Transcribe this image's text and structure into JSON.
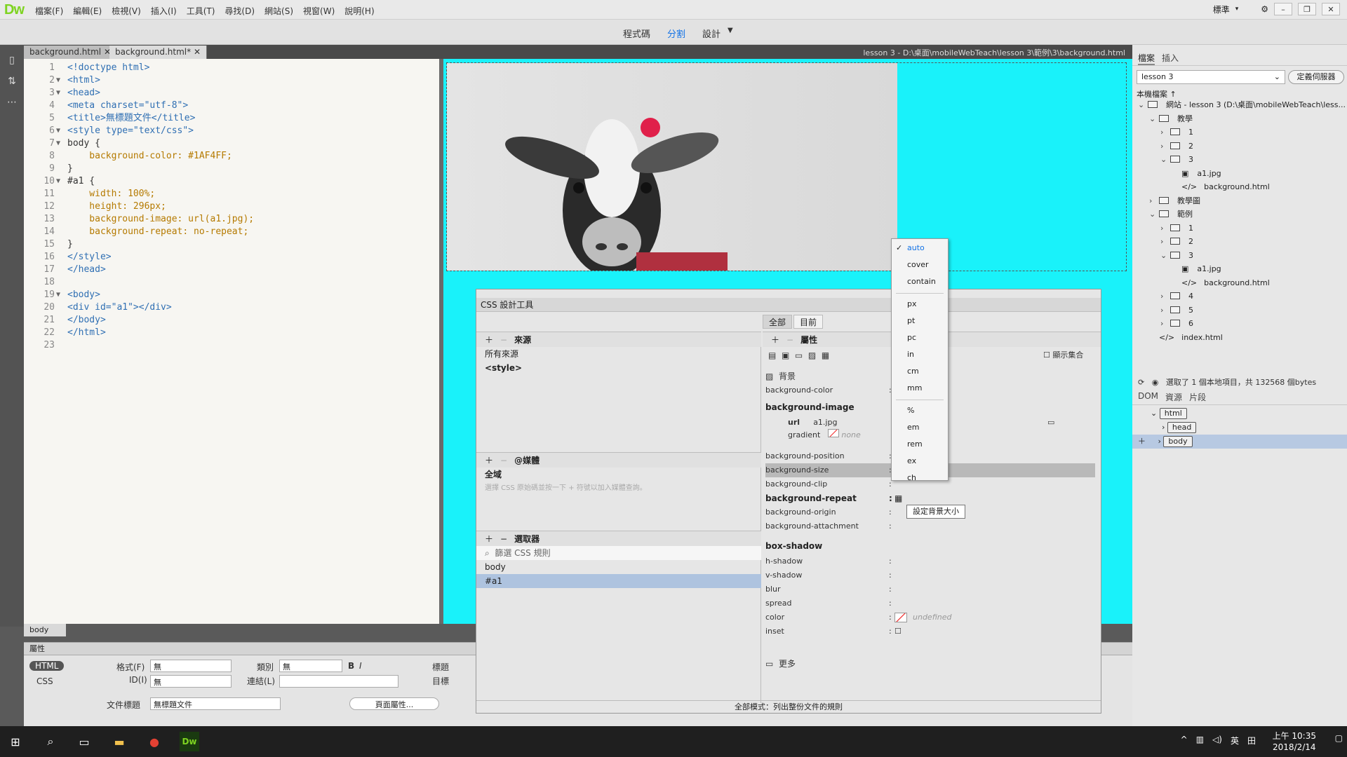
{
  "app": {
    "logo": "Dw",
    "menus": [
      "檔案(F)",
      "編輯(E)",
      "檢視(V)",
      "插入(I)",
      "工具(T)",
      "尋找(D)",
      "網站(S)",
      "視窗(W)",
      "說明(H)"
    ],
    "workspace": "標準"
  },
  "view_tabs": [
    "程式碼",
    "分割",
    "設計"
  ],
  "doc_tabs": [
    "background.html",
    "background.html*"
  ],
  "doc_path": "lesson 3 - D:\\桌面\\mobileWebTeach\\lesson 3\\範例\\3\\background.html",
  "code_lines": [
    {
      "n": "1",
      "t": "<!doctype html>"
    },
    {
      "n": "2",
      "t": "<html>"
    },
    {
      "n": "3",
      "t": "<head>"
    },
    {
      "n": "4",
      "t": "<meta charset=\"utf-8\">"
    },
    {
      "n": "5",
      "t": "<title>無標題文件</title>"
    },
    {
      "n": "6",
      "t": "<style type=\"text/css\">"
    },
    {
      "n": "7",
      "t": "body {"
    },
    {
      "n": "8",
      "t": "    background-color: #1AF4FF;"
    },
    {
      "n": "9",
      "t": "}"
    },
    {
      "n": "10",
      "t": "#a1 {"
    },
    {
      "n": "11",
      "t": "    width: 100%;"
    },
    {
      "n": "12",
      "t": "    height: 296px;"
    },
    {
      "n": "13",
      "t": "    background-image: url(a1.jpg);"
    },
    {
      "n": "14",
      "t": "    background-repeat: no-repeat;"
    },
    {
      "n": "15",
      "t": "}"
    },
    {
      "n": "16",
      "t": "</style>"
    },
    {
      "n": "17",
      "t": "</head>"
    },
    {
      "n": "18",
      "t": ""
    },
    {
      "n": "19",
      "t": "<body>"
    },
    {
      "n": "20",
      "t": "<div id=\"a1\"></div>"
    },
    {
      "n": "21",
      "t": "</body>"
    },
    {
      "n": "22",
      "t": "</html>"
    },
    {
      "n": "23",
      "t": ""
    }
  ],
  "files_panel": {
    "tabs": [
      "檔案",
      "插入"
    ],
    "site": "lesson 3",
    "define_btn": "定義伺服器",
    "local_label": "本機檔案 ↑",
    "tree": [
      {
        "label": "網站 - lesson 3 (D:\\桌面\\mobileWebTeach\\less...",
        "depth": 0,
        "kind": "folder",
        "open": true
      },
      {
        "label": "教學",
        "depth": 1,
        "kind": "folder",
        "open": true
      },
      {
        "label": "1",
        "depth": 2,
        "kind": "folder",
        "open": false
      },
      {
        "label": "2",
        "depth": 2,
        "kind": "folder",
        "open": false
      },
      {
        "label": "3",
        "depth": 2,
        "kind": "folder",
        "open": true
      },
      {
        "label": "a1.jpg",
        "depth": 3,
        "kind": "image"
      },
      {
        "label": "background.html",
        "depth": 3,
        "kind": "html"
      },
      {
        "label": "教學圖",
        "depth": 1,
        "kind": "folder",
        "open": false
      },
      {
        "label": "範例",
        "depth": 1,
        "kind": "folder",
        "open": true
      },
      {
        "label": "1",
        "depth": 2,
        "kind": "folder",
        "open": false
      },
      {
        "label": "2",
        "depth": 2,
        "kind": "folder",
        "open": false
      },
      {
        "label": "3",
        "depth": 2,
        "kind": "folder",
        "open": true
      },
      {
        "label": "a1.jpg",
        "depth": 3,
        "kind": "image"
      },
      {
        "label": "background.html",
        "depth": 3,
        "kind": "html"
      },
      {
        "label": "4",
        "depth": 2,
        "kind": "folder",
        "open": false
      },
      {
        "label": "5",
        "depth": 2,
        "kind": "folder",
        "open": false
      },
      {
        "label": "6",
        "depth": 2,
        "kind": "folder",
        "open": false
      },
      {
        "label": "index.html",
        "depth": 1,
        "kind": "html"
      }
    ],
    "status": "選取了 1 個本地項目，共 132568 個bytes"
  },
  "dom_panel": {
    "tabs": [
      "DOM",
      "資源",
      "片段"
    ],
    "nodes": [
      "html",
      "head",
      "body"
    ]
  },
  "css_panel": {
    "title": "CSS 設計工具",
    "modes": [
      "全部",
      "目前"
    ],
    "sources_hdr": "來源",
    "sources": [
      "所有來源",
      "<style>"
    ],
    "media_hdr": "@媒體",
    "media_item": "全域",
    "media_hint": "選擇 CSS 原始碼並按一下 + 符號以加入媒體查詢。",
    "selectors_hdr": "選取器",
    "filter_placeholder": "篩選 CSS 規則",
    "selectors": [
      "body",
      "#a1"
    ],
    "props_hdr": "屬性",
    "show_set": "顯示集合",
    "bg_section": "背景",
    "bg_rows": [
      "background-color",
      "background-image"
    ],
    "url_label": "url",
    "url_value": "a1.jpg",
    "gradient_label": "gradient",
    "gradient_value": "none",
    "rows2": [
      "background-position",
      "background-size",
      "background-clip",
      "background-repeat",
      "background-origin",
      "background-attachment"
    ],
    "size_values": [
      "auto",
      "auto"
    ],
    "box_shadow": "box-shadow",
    "shadow_rows": [
      "h-shadow",
      "v-shadow",
      "blur",
      "spread",
      "color",
      "inset"
    ],
    "color_value": "undefined",
    "more": "更多",
    "footer": "全部模式：列出整份文件的規則"
  },
  "dropdown": {
    "selected": "auto",
    "groups": [
      [
        "auto",
        "cover",
        "contain"
      ],
      [
        "px",
        "pt",
        "pc",
        "in",
        "cm",
        "mm"
      ],
      [
        "%",
        "em",
        "rem",
        "ex",
        "ch"
      ]
    ]
  },
  "tooltip": "設定背景大小",
  "tag_selector": "body",
  "properties": {
    "title": "屬性",
    "html_btn": "HTML",
    "css_btn": "CSS",
    "format_label": "格式(F)",
    "format_val": "無",
    "class_label": "類別",
    "class_val": "無",
    "id_label": "ID(I)",
    "id_val": "無",
    "link_label": "連結(L)",
    "title_label": "標題",
    "target_label": "目標",
    "doctitle_label": "文件標題",
    "doctitle_val": "無標題文件",
    "pageprops_btn": "頁面屬性..."
  },
  "taskbar": {
    "time": "上午 10:35",
    "date": "2018/2/14",
    "ime": "英"
  },
  "colors": {
    "design_bg": "#1AF4FF",
    "accent": "#1473e6"
  }
}
